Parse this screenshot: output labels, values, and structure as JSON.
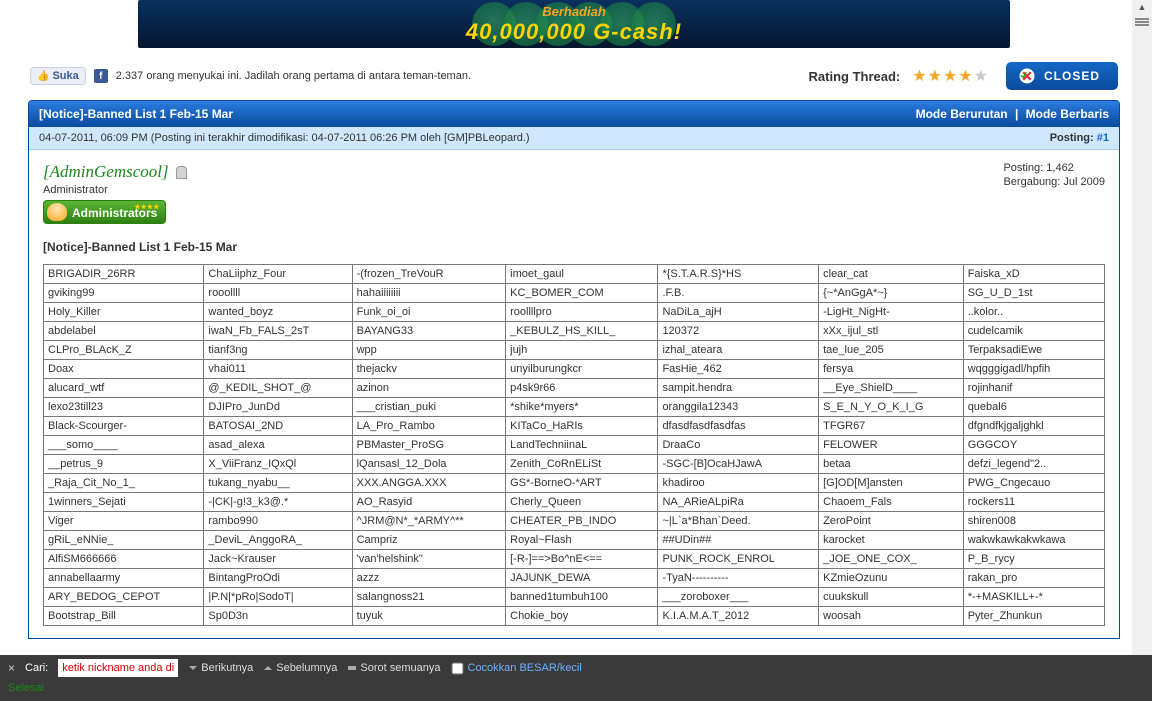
{
  "banner": {
    "line1": "Berhadiah",
    "line2": "40,000,000 G-cash!"
  },
  "social": {
    "like": "Suka",
    "text": "2.337 orang menyukai ini. Jadilah orang pertama di antara teman-teman."
  },
  "rating": {
    "label": "Rating Thread:",
    "value": 4
  },
  "closed_label": "CLOSED",
  "thread": {
    "title": "[Notice]-Banned List 1 Feb-15 Mar",
    "mode_sequential": "Mode Berurutan",
    "mode_inline": "Mode Berbaris"
  },
  "meta": {
    "text": "04-07-2011, 06:09 PM (Posting ini terakhir dimodifikasi: 04-07-2011 06:26 PM oleh [GM]PBLeopard.)",
    "post_label": "Posting:",
    "post_num": "#1"
  },
  "author": {
    "name": "AdminGemscool",
    "role": "Administrator",
    "badge": "Administrators",
    "stat1": "Posting: 1,462",
    "stat2": "Bergabung: Jul 2009"
  },
  "post_title": "[Notice]-Banned List 1 Feb-15 Mar",
  "banned_rows": [
    [
      "BRIGADIR_26RR",
      "ChaLiiphz_Four",
      "-(frozen_TreVouR",
      "imoet_gaul",
      "*{S.T.A.R.S}*HS",
      "clear_cat",
      "Faiska_xD"
    ],
    [
      " gviking99",
      "rooollll",
      " hahaiiiiiiii",
      "KC_BOMER_COM",
      ".F.B.",
      "{~*AnGgA*~}",
      "SG_U_D_1st"
    ],
    [
      " Holy_Killer",
      "wanted_boyz",
      "Funk_oi_oi",
      " roollllpro",
      " NaDiLa_ajH",
      "-LigHt_NigHt-",
      "..kolor.."
    ],
    [
      "abdelabel",
      " iwaN_Fb_FALS_2sT",
      " BAYANG33",
      "_KEBULZ_HS_KILL_",
      "120372",
      "xXx_ijul_stl",
      "cudelcamik"
    ],
    [
      "CLPro_BLAcK_Z",
      "tianf3ng",
      " wpp",
      "jujh",
      " izhal_ateara",
      "tae_lue_205",
      "TerpaksadiEwe"
    ],
    [
      " Doax",
      " vhai011",
      "thejackv",
      "unyilburungkcr",
      "FasHie_462",
      "fersya",
      "wqgggigadl/hpfih"
    ],
    [
      "alucard_wtf",
      "@_KEDIL_SHOT_@",
      "azinon",
      "p4sk9r66",
      "sampit.hendra",
      "__Eye_ShielD____",
      "rojinhanif"
    ],
    [
      " lexo23till23",
      " DJIPro_JunDd",
      "___cristian_puki",
      "*shike*myers*",
      " oranggila12343",
      " S_E_N_Y_O_K_I_G",
      "quebal6"
    ],
    [
      "Black-Scourger-",
      "BATOSAI_2ND",
      "LA_Pro_Rambo",
      "KITaCo_HaRIs",
      " dfasdfasdfasdfas",
      " TFGR67",
      "dfgndfkjgaljghkl"
    ],
    [
      "___somo____",
      "asad_alexa",
      "PBMaster_ProSG",
      "LandTechniinaL",
      "DraaCo",
      "FELOWER",
      "GGGCOY"
    ],
    [
      "__petrus_9",
      " X_ViiFranz_IQxQl",
      "lQansasl_12_Dola",
      "Zenith_CoRnELiSt",
      " -SGC-[B]OcaHJawA",
      "betaa",
      "defzi_legend\"2.."
    ],
    [
      "_Raja_Cit_No_1_",
      " tukang_nyabu__",
      "XXX.ANGGA.XXX",
      "GS*-BorneO-*ART",
      "khadiroo",
      "[G]OD[M]ansten",
      "PWG_Cngecauo"
    ],
    [
      "1winners_Sejati",
      " -|CK|-g!3_k3@.*",
      "AO_Rasyid",
      " Cherly_Queen",
      "NA_ARieALpiRa",
      " Chaoem_Fals",
      "rockers11"
    ],
    [
      "Viger",
      "rambo990",
      "^JRM@N*_*ARMY^**",
      "CHEATER_PB_INDO",
      " ~|L`a*Bhan`Deed.",
      "ZeroPoint",
      "shiren008"
    ],
    [
      " gRiL_eNNie_",
      "_DeviL_AnggoRA_",
      "Campriz",
      "Royal~Flash",
      "##UDin##",
      "karocket",
      "wakwkawkakwkawa"
    ],
    [
      "AlfiSM666666",
      "Jack~Krauser",
      "'van'helshink\"",
      "[-R-]==>Bo^nE<==",
      "PUNK_ROCK_ENROL",
      "_JOE_ONE_COX_",
      "P_B_rycy"
    ],
    [
      "annabellaarmy",
      "BintangProOdi",
      "azzz",
      "JAJUNK_DEWA",
      "-TyaN----------",
      " KZmieOzunu",
      "rakan_pro"
    ],
    [
      " ARY_BEDOG_CEPOT",
      "|P.N|*pRo|SodoT|",
      "salangnoss21",
      "banned1tumbuh100",
      "___zoroboxer___",
      "cuukskull",
      "*-+MASKILL+-*"
    ],
    [
      "Bootstrap_Bill",
      "Sp0D3n",
      "tuyuk",
      "Chokie_boy",
      "K.I.A.M.A.T_2012",
      "woosah",
      "Pyter_Zhunkun"
    ]
  ],
  "findbar": {
    "close": "×",
    "label": "Cari:",
    "placeholder": "ketik nickname anda disini",
    "next": "Berikutnya",
    "prev": "Sebelumnya",
    "highlight_all": "Sorot semuanya",
    "match_case": "Cocokkan BESAR/kecil",
    "status": "Selesai"
  }
}
